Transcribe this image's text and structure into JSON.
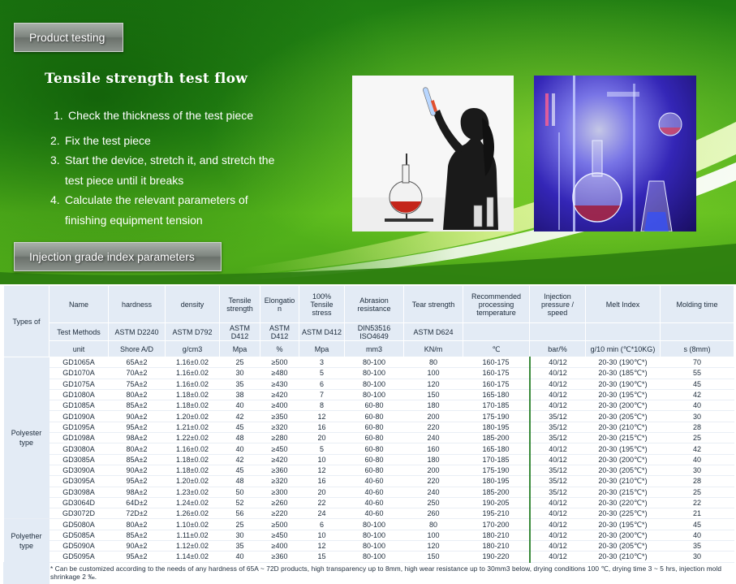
{
  "header": {
    "product_testing_label": "Product testing",
    "injection_label": "Injection grade index parameters"
  },
  "flow": {
    "title": "Tensile strength test flow",
    "steps": [
      {
        "num": "1.",
        "text": "Check the thickness of the test piece"
      },
      {
        "num": "2.",
        "text": "Fix the test piece"
      },
      {
        "num": "3.",
        "text": "Start the device, stretch it, and stretch the test piece until it breaks"
      },
      {
        "num": "4.",
        "text": "Calculate the relevant   parameters  of finishing equipment tension"
      }
    ]
  },
  "table": {
    "types_label": "Types of",
    "names_row": [
      "Name",
      "hardness",
      "density",
      "Tensile strength",
      "Elongatio n",
      "100% Tensile stress",
      "Abrasion resistance",
      "Tear strength",
      "Recommended processing temperature",
      "Injection pressure / speed",
      "Melt Index",
      "Molding time"
    ],
    "methods_row": [
      "Test Methods",
      "ASTM  D2240",
      "ASTM D792",
      "ASTM D412",
      "ASTM D412",
      "ASTM D412",
      "DIN53516 ISO4649",
      "ASTM D624",
      "",
      "",
      "",
      ""
    ],
    "units_row": [
      "unit",
      "Shore A/D",
      "g/cm3",
      "Mpa",
      "%",
      "Mpa",
      "mm3",
      "KN/m",
      "℃",
      "bar/%",
      "g/10 min (℃*10KG)",
      "s  (8mm)"
    ],
    "groups": [
      {
        "label": "Polyester type",
        "rows": [
          [
            "GD1065A",
            "65A±2",
            "1.16±0.02",
            "25",
            "≥500",
            "3",
            "80-100",
            "80",
            "160-175",
            "40/12",
            "20-30 (190℃*)",
            "70"
          ],
          [
            "GD1070A",
            "70A±2",
            "1.16±0.02",
            "30",
            "≥480",
            "5",
            "80-100",
            "100",
            "160-175",
            "40/12",
            "20-30 (185℃*)",
            "55"
          ],
          [
            "GD1075A",
            "75A±2",
            "1.16±0.02",
            "35",
            "≥430",
            "6",
            "80-100",
            "120",
            "160-175",
            "40/12",
            "20-30 (190℃*)",
            "45"
          ],
          [
            "GD1080A",
            "80A±2",
            "1.18±0.02",
            "38",
            "≥420",
            "7",
            "80-100",
            "150",
            "165-180",
            "40/12",
            "20-30 (195℃*)",
            "42"
          ],
          [
            "GD1085A",
            "85A±2",
            "1.18±0.02",
            "40",
            "≥400",
            "8",
            "60-80",
            "180",
            "170-185",
            "40/12",
            "20-30 (200℃*)",
            "40"
          ],
          [
            "GD1090A",
            "90A±2",
            "1.20±0.02",
            "42",
            "≥350",
            "12",
            "60-80",
            "200",
            "175-190",
            "35/12",
            "20-30 (205℃*)",
            "30"
          ],
          [
            "GD1095A",
            "95A±2",
            "1.21±0.02",
            "45",
            "≥320",
            "16",
            "60-80",
            "220",
            "180-195",
            "35/12",
            "20-30 (210℃*)",
            "28"
          ],
          [
            "GD1098A",
            "98A±2",
            "1.22±0.02",
            "48",
            "≥280",
            "20",
            "60-80",
            "240",
            "185-200",
            "35/12",
            "20-30 (215℃*)",
            "25"
          ],
          [
            "GD3080A",
            "80A±2",
            "1.16±0.02",
            "40",
            "≥450",
            "5",
            "60-80",
            "160",
            "165-180",
            "40/12",
            "20-30 (195℃*)",
            "42"
          ],
          [
            "GD3085A",
            "85A±2",
            "1.18±0.02",
            "42",
            "≥420",
            "10",
            "60-80",
            "180",
            "170-185",
            "40/12",
            "20-30 (200℃*)",
            "40"
          ],
          [
            "GD3090A",
            "90A±2",
            "1.18±0.02",
            "45",
            "≥360",
            "12",
            "60-80",
            "200",
            "175-190",
            "35/12",
            "20-30 (205℃*)",
            "30"
          ],
          [
            "GD3095A",
            "95A±2",
            "1.20±0.02",
            "48",
            "≥320",
            "16",
            "40-60",
            "220",
            "180-195",
            "35/12",
            "20-30 (210℃*)",
            "28"
          ],
          [
            "GD3098A",
            "98A±2",
            "1.23±0.02",
            "50",
            "≥300",
            "20",
            "40-60",
            "240",
            "185-200",
            "35/12",
            "20-30 (215℃*)",
            "25"
          ],
          [
            "GD3064D",
            "64D±2",
            "1.24±0.02",
            "52",
            "≥260",
            "22",
            "40-60",
            "250",
            "190-205",
            "40/12",
            "20-30 (220℃*)",
            "22"
          ],
          [
            "GD3072D",
            "72D±2",
            "1.26±0.02",
            "56",
            "≥220",
            "24",
            "40-60",
            "260",
            "195-210",
            "40/12",
            "20-30 (225℃*)",
            "21"
          ]
        ]
      },
      {
        "label": "Polyether type",
        "rows": [
          [
            "GD5080A",
            "80A±2",
            "1.10±0.02",
            "25",
            "≥500",
            "6",
            "80-100",
            "80",
            "170-200",
            "40/12",
            "20-30 (195℃*)",
            "45"
          ],
          [
            "GD5085A",
            "85A±2",
            "1.11±0.02",
            "30",
            "≥450",
            "10",
            "80-100",
            "100",
            "180-210",
            "40/12",
            "20-30 (200℃*)",
            "40"
          ],
          [
            "GD5090A",
            "90A±2",
            "1.12±0.02",
            "35",
            "≥400",
            "12",
            "80-100",
            "120",
            "180-210",
            "40/12",
            "20-30 (205℃*)",
            "35"
          ],
          [
            "GD5095A",
            "95A±2",
            "1.14±0.02",
            "40",
            "≥360",
            "15",
            "80-100",
            "150",
            "190-220",
            "40/12",
            "20-30 (210℃*)",
            "30"
          ]
        ]
      }
    ],
    "footnote": "* Can be customized according to the needs of any hardness of 65A ~ 72D products, high transparency up to 8mm, high wear resistance up to 30mm3 below, drying conditions 100 ℃, drying time 3 ~ 5 hrs, injection mold shrinkage 2 ‰."
  },
  "colors": {
    "banner_green": "#2f9a18",
    "header_cell": "#e3ebf5",
    "text": "#1b2a3a"
  },
  "images": {
    "left": "scientist-silhouette-with-flask",
    "right": "blue-lit-laboratory-glassware"
  }
}
